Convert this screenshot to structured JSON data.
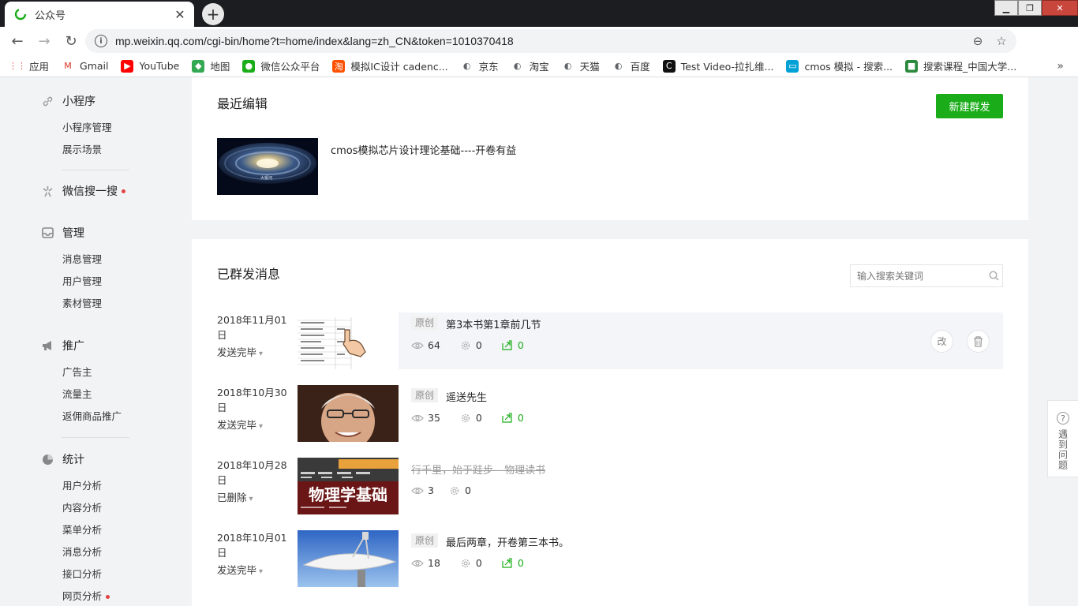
{
  "browser": {
    "tab_title": "公众号",
    "new_tab_label": "+",
    "url": "mp.weixin.qq.com/cgi-bin/home?t=home/index&lang=zh_CN&token=1010370418",
    "bookmarks": [
      {
        "label": "应用",
        "icon": "apps-grid-icon",
        "color": "#e8453c"
      },
      {
        "label": "Gmail",
        "icon": "gmail-icon",
        "color": "#d93025"
      },
      {
        "label": "YouTube",
        "icon": "youtube-icon",
        "color": "#ff0000"
      },
      {
        "label": "地图",
        "icon": "maps-icon",
        "color": "#34a853"
      },
      {
        "label": "微信公众平台",
        "icon": "wechat-icon",
        "color": "#1aad19"
      },
      {
        "label": "模拟IC设计 cadenc...",
        "icon": "taobao-icon",
        "color": "#ff5000"
      },
      {
        "label": "京东",
        "icon": "globe-icon",
        "color": "#5f6368"
      },
      {
        "label": "淘宝",
        "icon": "globe-icon",
        "color": "#5f6368"
      },
      {
        "label": "天猫",
        "icon": "globe-icon",
        "color": "#5f6368"
      },
      {
        "label": "百度",
        "icon": "globe-icon",
        "color": "#5f6368"
      },
      {
        "label": "Test Video-拉扎维...",
        "icon": "video-icon",
        "color": "#111111"
      },
      {
        "label": "cmos 模拟 - 搜索...",
        "icon": "bilibili-icon",
        "color": "#00a1d6"
      },
      {
        "label": "搜索课程_中国大学...",
        "icon": "mooc-icon",
        "color": "#2b8a3e"
      }
    ],
    "more_label": "»"
  },
  "sidebar": {
    "groups": [
      {
        "title": "小程序",
        "icon": "link-icon",
        "items": [
          "小程序管理",
          "展示场景"
        ],
        "dot": false
      },
      {
        "title": "微信搜一搜",
        "icon": "sparkle-icon",
        "items": [],
        "dot": true
      },
      {
        "title": "管理",
        "icon": "inbox-icon",
        "items": [
          "消息管理",
          "用户管理",
          "素材管理"
        ],
        "dot": false
      },
      {
        "title": "推广",
        "icon": "megaphone-icon",
        "items": [
          "广告主",
          "流量主",
          "返佣商品推广"
        ],
        "dot": false
      },
      {
        "title": "统计",
        "icon": "pie-chart-icon",
        "items": [
          "用户分析",
          "内容分析",
          "菜单分析",
          "消息分析",
          "接口分析",
          "网页分析"
        ],
        "dot": false,
        "dot_item": "网页分析"
      }
    ]
  },
  "recent": {
    "heading": "最近编辑",
    "new_button": "新建群发",
    "item_title": "cmos模拟芯片设计理论基础----开卷有益"
  },
  "sent": {
    "heading": "已群发消息",
    "search_placeholder": "输入搜索关键词",
    "messages": [
      {
        "date": "2018年11月01日",
        "status": "发送完毕",
        "tag": "原创",
        "title": "第3本书第1章前几节",
        "views": "64",
        "likes": "0",
        "shares": "0",
        "deleted": false
      },
      {
        "date": "2018年10月30日",
        "status": "发送完毕",
        "tag": "原创",
        "title": "遥送先生",
        "views": "35",
        "likes": "0",
        "shares": "0",
        "deleted": false
      },
      {
        "date": "2018年10月28日",
        "status": "已删除",
        "tag": "",
        "title": "行千里，始于跬步---物理读书",
        "views": "3",
        "likes": "0",
        "shares": "",
        "deleted": true
      },
      {
        "date": "2018年10月01日",
        "status": "发送完毕",
        "tag": "原创",
        "title": "最后两章，开卷第三本书。",
        "views": "18",
        "likes": "0",
        "shares": "0",
        "deleted": false
      }
    ],
    "edit_label": "改"
  },
  "help": {
    "label": "遇到问题",
    "q": "?"
  },
  "thumbs": {
    "physics_book_title": "物理学基础",
    "galaxy_caption": "大银河"
  }
}
